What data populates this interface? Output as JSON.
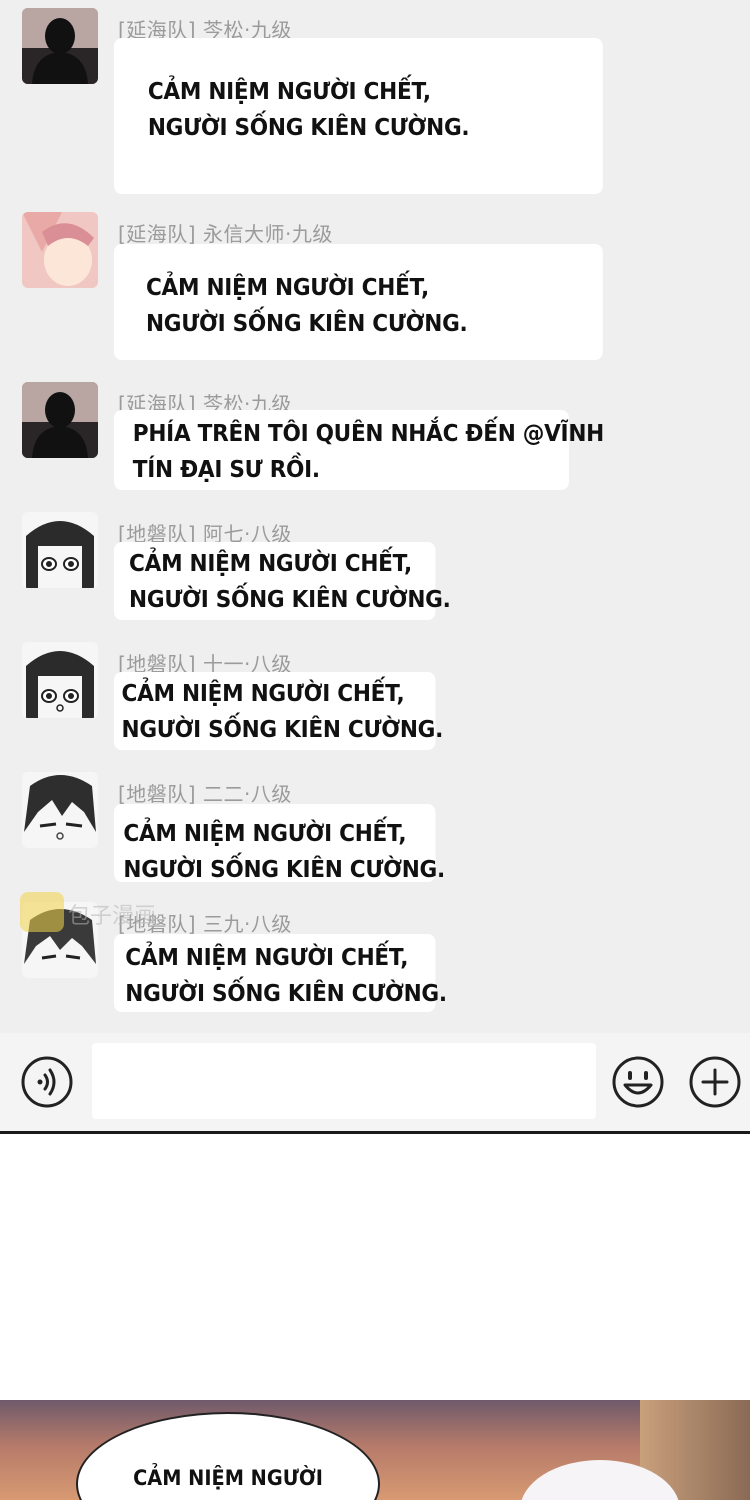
{
  "messages": [
    {
      "sender": "[延海队] 芩松·九级",
      "avatar_icon": "silhouette-avatar",
      "lines": [
        "CẢM NIỆM NGƯỜI CHẾT,",
        "NGƯỜI SỐNG KIÊN CƯỜNG."
      ]
    },
    {
      "sender": "[延海队] 永信大师·九级",
      "avatar_icon": "pink-anime-avatar",
      "lines": [
        "CẢM NIỆM NGƯỜI CHẾT,",
        "NGƯỜI SỐNG KIÊN CƯỜNG."
      ]
    },
    {
      "sender": "[延海队] 芩松·九级",
      "avatar_icon": "silhouette-avatar",
      "lines": [
        "PHÍA TRÊN TÔI QUÊN NHẮC ĐẾN @VĨNH",
        "TÍN ĐẠI SƯ RỒI."
      ]
    },
    {
      "sender": "[地磐队] 阿七·八级",
      "avatar_icon": "anime-girl-avatar",
      "lines": [
        "CẢM NIỆM NGƯỜI CHẾT,",
        "NGƯỜI SỐNG KIÊN CƯỜNG."
      ]
    },
    {
      "sender": "[地磐队] 十一·八级",
      "avatar_icon": "anime-girl-avatar",
      "lines": [
        "CẢM NIỆM NGƯỜI CHẾT,",
        "NGƯỜI SỐNG KIÊN CƯỜNG."
      ]
    },
    {
      "sender": "[地磐队] 二二·八级",
      "avatar_icon": "anime-boy-avatar",
      "lines": [
        "CẢM NIỆM NGƯỜI CHẾT,",
        "NGƯỜI SỐNG KIÊN CƯỜNG."
      ]
    },
    {
      "sender": "[地磐队] 三九·八级",
      "avatar_icon": "anime-boy-avatar",
      "lines": [
        "CẢM NIỆM NGƯỜI CHẾT,",
        "NGƯỜI SỐNG KIÊN CƯỜNG."
      ]
    }
  ],
  "watermark": {
    "text": "包子漫画"
  },
  "input_bar": {
    "voice_icon": "voice-icon",
    "emoji_icon": "smiley-icon",
    "plus_icon": "plus-icon",
    "input_value": ""
  },
  "next_panel": {
    "speech_text": "CẢM NIỆM NGƯỜI"
  }
}
